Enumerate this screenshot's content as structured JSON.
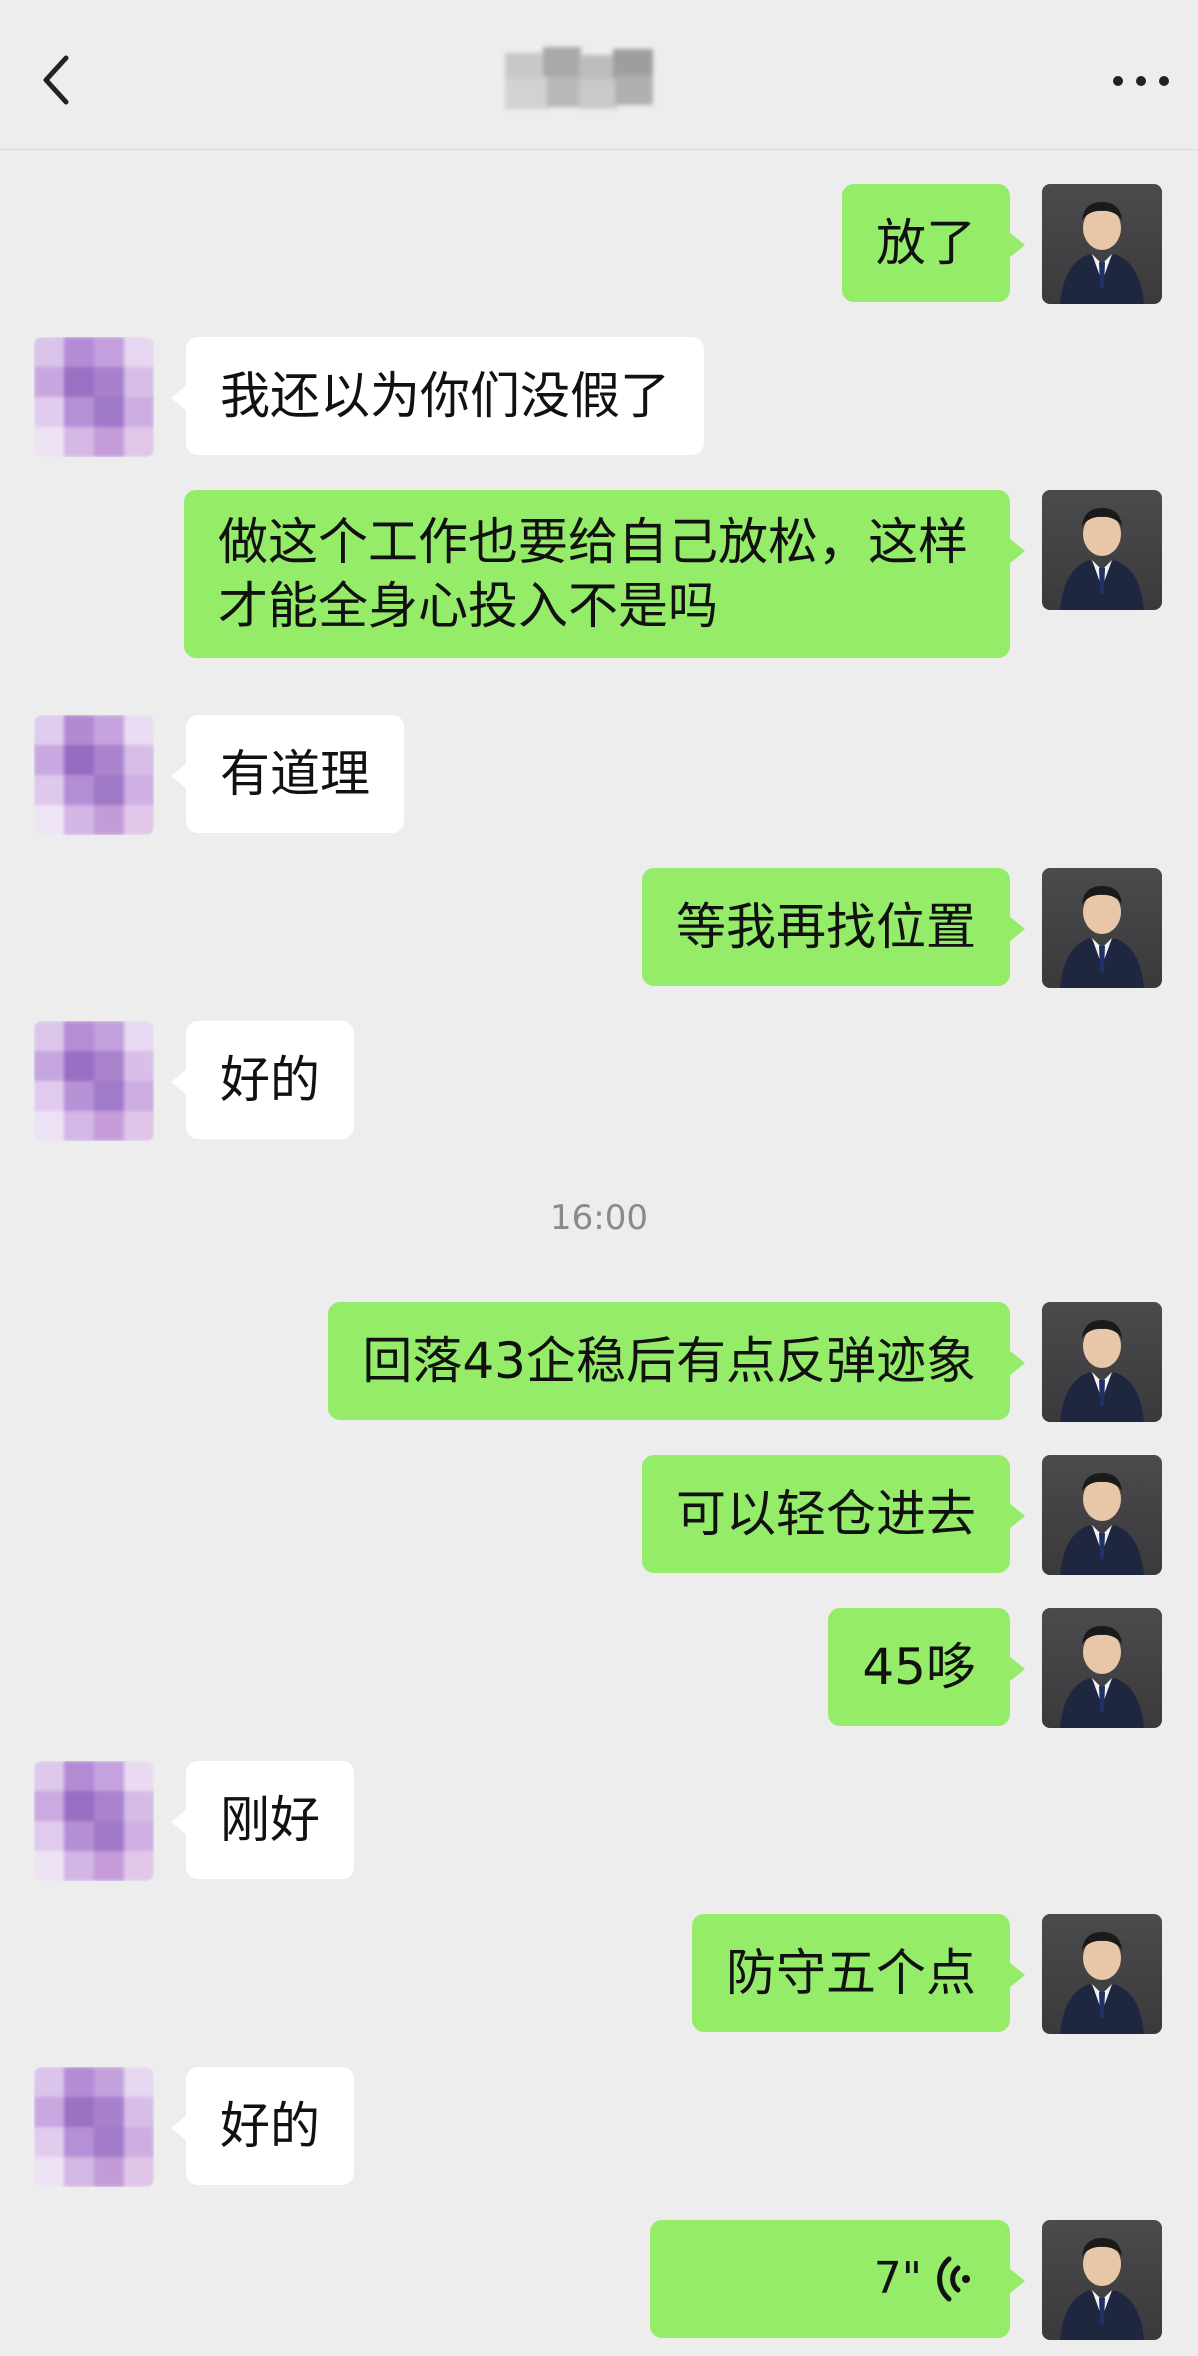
{
  "header": {
    "back_icon": "chevron-left-icon",
    "title": "",
    "more_icon": "more-dots-icon"
  },
  "colors": {
    "background": "#EDEDED",
    "me_bubble": "#95EC69",
    "other_bubble": "#FFFFFF",
    "timestamp_text": "#8A8A8A"
  },
  "messages": [
    {
      "sender": "me",
      "text": "放了"
    },
    {
      "sender": "other",
      "text": "我还以为你们没假了"
    },
    {
      "sender": "me",
      "text": "做这个工作也要给自己放松，这样才能全身心投入不是吗"
    },
    {
      "sender": "other",
      "text": "有道理"
    },
    {
      "sender": "me",
      "text": "等我再找位置"
    },
    {
      "sender": "other",
      "text": "好的"
    },
    {
      "sender": "me",
      "text": "回落43企稳后有点反弹迹象"
    },
    {
      "sender": "me",
      "text": "可以轻仓进去"
    },
    {
      "sender": "me",
      "text": "45哆"
    },
    {
      "sender": "other",
      "text": "刚好"
    },
    {
      "sender": "me",
      "text": "防守五个点"
    },
    {
      "sender": "other",
      "text": "好的"
    },
    {
      "sender": "me",
      "type": "voice",
      "text": "7\"",
      "icon": "voice-wave-icon"
    }
  ],
  "timestamp": "16:00"
}
